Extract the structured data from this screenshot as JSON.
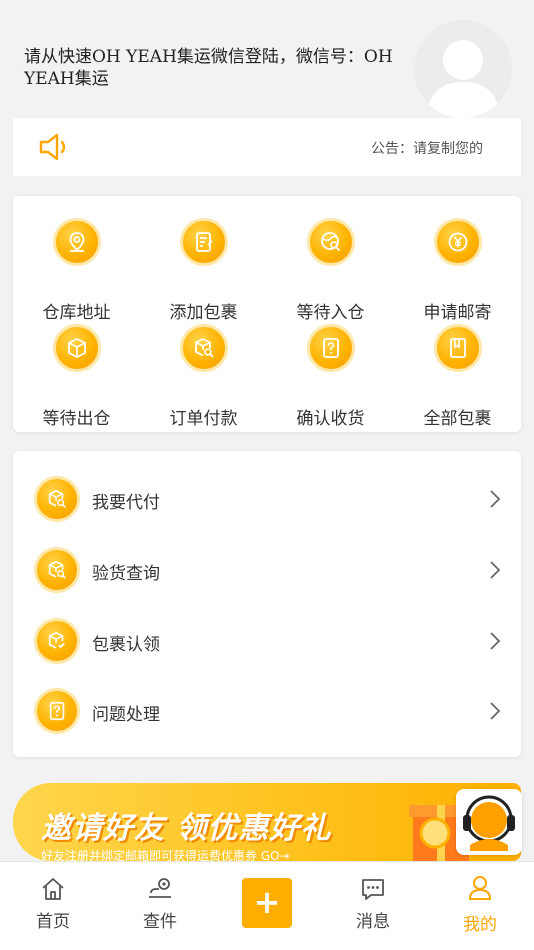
{
  "header": {
    "welcome_text": "请从快速OH YEAH集运微信登陆，微信号：OH YEAH集运"
  },
  "notice": {
    "text": "公告：请复制您的"
  },
  "grid": {
    "items": [
      {
        "label": "仓库地址",
        "icon": "location-icon"
      },
      {
        "label": "添加包裹",
        "icon": "edit-doc-icon"
      },
      {
        "label": "等待入仓",
        "icon": "globe-search-icon"
      },
      {
        "label": "申请邮寄",
        "icon": "yuan-icon"
      },
      {
        "label": "等待出仓",
        "icon": "box-icon"
      },
      {
        "label": "订单付款",
        "icon": "box-search-icon"
      },
      {
        "label": "确认收货",
        "icon": "question-doc-icon"
      },
      {
        "label": "全部包裹",
        "icon": "book-icon"
      }
    ]
  },
  "list": {
    "items": [
      {
        "label": "我要代付",
        "icon": "box-search-icon"
      },
      {
        "label": "验货查询",
        "icon": "box-search-icon"
      },
      {
        "label": "包裹认领",
        "icon": "box-check-icon"
      },
      {
        "label": "问题处理",
        "icon": "question-doc-icon"
      }
    ]
  },
  "banner": {
    "title": "邀请好友 领优惠好礼",
    "subtitle": "好友注册并绑定邮箱即可获得运费优惠券 GO→"
  },
  "tabbar": {
    "items": [
      {
        "label": "首页",
        "icon": "home-icon"
      },
      {
        "label": "查件",
        "icon": "track-icon"
      },
      {
        "label": "",
        "icon": "plus-icon"
      },
      {
        "label": "消息",
        "icon": "message-icon"
      },
      {
        "label": "我的",
        "icon": "user-icon"
      }
    ],
    "plus_symbol": "+"
  },
  "colors": {
    "accent": "#ffae00",
    "active_tab": "#ffa600",
    "background": "#f2f2f4"
  }
}
